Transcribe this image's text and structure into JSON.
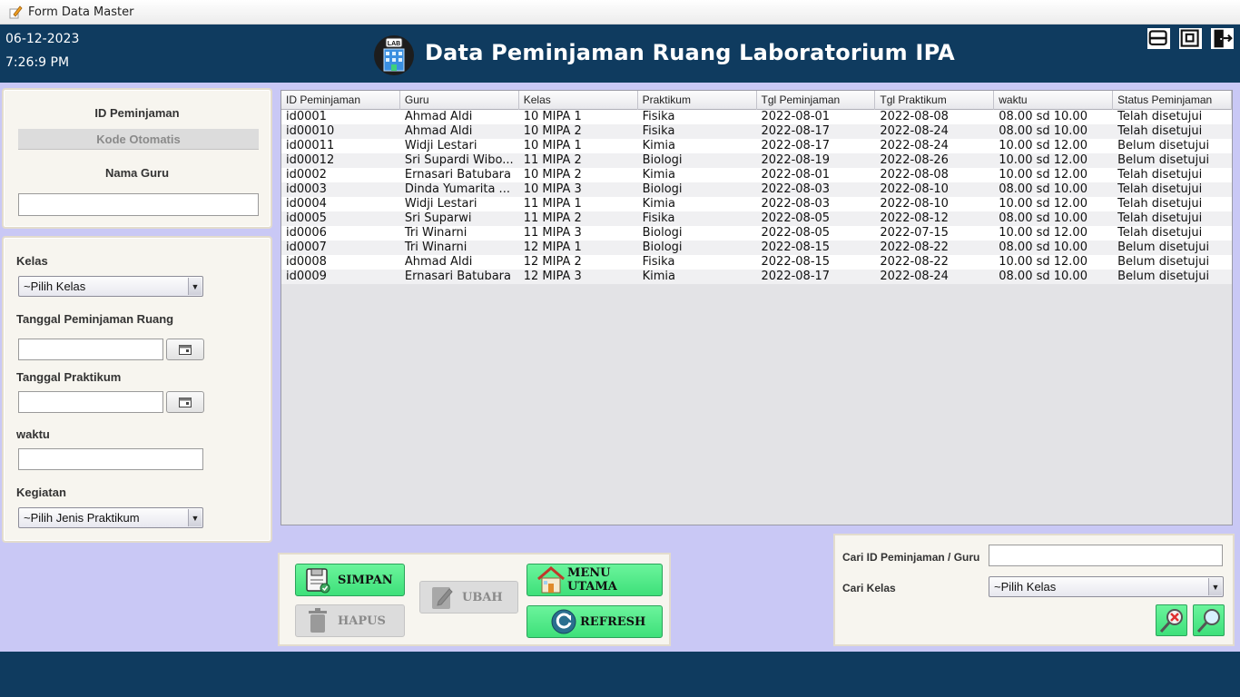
{
  "window": {
    "title": "Form Data Master"
  },
  "header": {
    "date": "06-12-2023",
    "time": "7:26:9 PM",
    "title": "Data Peminjaman Ruang Laboratorium IPA",
    "logo_text": "LAB"
  },
  "form": {
    "id_label": "ID Peminjaman",
    "id_value": "Kode Otomatis",
    "guru_label": "Nama Guru",
    "guru_value": "",
    "kelas_label": "Kelas",
    "kelas_selected": "~Pilih Kelas",
    "tgl_pinjam_label": "Tanggal Peminjaman Ruang",
    "tgl_pinjam_value": "",
    "tgl_praktikum_label": "Tanggal Praktikum",
    "tgl_praktikum_value": "",
    "waktu_label": "waktu",
    "waktu_value": "",
    "kegiatan_label": "Kegiatan",
    "kegiatan_selected": "~Pilih Jenis Praktikum"
  },
  "table": {
    "columns": [
      "ID Peminjaman",
      "Guru",
      "Kelas",
      "Praktikum",
      "Tgl Peminjaman",
      "Tgl Praktikum",
      "waktu",
      "Status Peminjaman"
    ],
    "rows": [
      [
        "id0001",
        "Ahmad Aldi",
        "10 MIPA 1",
        "Fisika",
        "2022-08-01",
        "2022-08-08",
        "08.00 sd 10.00",
        "Telah disetujui"
      ],
      [
        "id00010",
        "Ahmad Aldi",
        "10 MIPA 2",
        "Fisika",
        "2022-08-17",
        "2022-08-24",
        "08.00 sd 10.00",
        "Telah disetujui"
      ],
      [
        "id00011",
        "Widji Lestari",
        "10 MIPA 1",
        "Kimia",
        "2022-08-17",
        "2022-08-24",
        "10.00 sd 12.00",
        "Belum disetujui"
      ],
      [
        "id00012",
        "Sri Supardi Wibo...",
        "11 MIPA 2",
        "Biologi",
        "2022-08-19",
        "2022-08-26",
        "10.00 sd 12.00",
        "Belum disetujui"
      ],
      [
        "id0002",
        "Ernasari Batubara",
        "10 MIPA 2",
        "Kimia",
        "2022-08-01",
        "2022-08-08",
        "10.00 sd 12.00",
        "Telah disetujui"
      ],
      [
        "id0003",
        "Dinda Yumarita ...",
        "10 MIPA 3",
        "Biologi",
        "2022-08-03",
        "2022-08-10",
        "08.00 sd 10.00",
        "Telah disetujui"
      ],
      [
        "id0004",
        "Widji Lestari",
        "11 MIPA 1",
        "Kimia",
        "2022-08-03",
        "2022-08-10",
        "10.00 sd 12.00",
        "Telah disetujui"
      ],
      [
        "id0005",
        "Sri Suparwi",
        "11 MIPA 2",
        "Fisika",
        "2022-08-05",
        "2022-08-12",
        "08.00 sd 10.00",
        "Telah disetujui"
      ],
      [
        "id0006",
        "Tri Winarni",
        "11 MIPA 3",
        "Biologi",
        "2022-08-05",
        "2022-07-15",
        "10.00 sd 12.00",
        "Telah disetujui"
      ],
      [
        "id0007",
        "Tri Winarni",
        "12 MIPA 1",
        "Biologi",
        "2022-08-15",
        "2022-08-22",
        "08.00 sd 10.00",
        "Belum disetujui"
      ],
      [
        "id0008",
        "Ahmad Aldi",
        "12 MIPA 2",
        "Fisika",
        "2022-08-15",
        "2022-08-22",
        "10.00 sd 12.00",
        "Belum disetujui"
      ],
      [
        "id0009",
        "Ernasari Batubara",
        "12 MIPA 3",
        "Kimia",
        "2022-08-17",
        "2022-08-24",
        "08.00 sd 10.00",
        "Belum disetujui"
      ]
    ]
  },
  "buttons": {
    "simpan": "SIMPAN",
    "hapus": "HAPUS",
    "ubah": "UBAH",
    "menu_utama": "MENU UTAMA",
    "refresh": "REFRESH"
  },
  "search": {
    "id_guru_label": "Cari ID Peminjaman / Guru",
    "id_guru_value": "",
    "kelas_label": "Cari Kelas",
    "kelas_selected": "~Pilih Kelas"
  },
  "colors": {
    "header_bg": "#0f3b5f",
    "page_bg": "#c9c8f5",
    "button_green": "#3ee07a",
    "panel_bg": "#f7f5ef"
  },
  "icons": [
    "pencil-app-icon",
    "lab-logo-icon",
    "minimize-icon",
    "maximize-icon",
    "exit-icon",
    "calendar-icon",
    "save-icon",
    "trash-icon",
    "edit-icon",
    "home-icon",
    "refresh-icon",
    "clear-search-icon",
    "search-icon"
  ]
}
